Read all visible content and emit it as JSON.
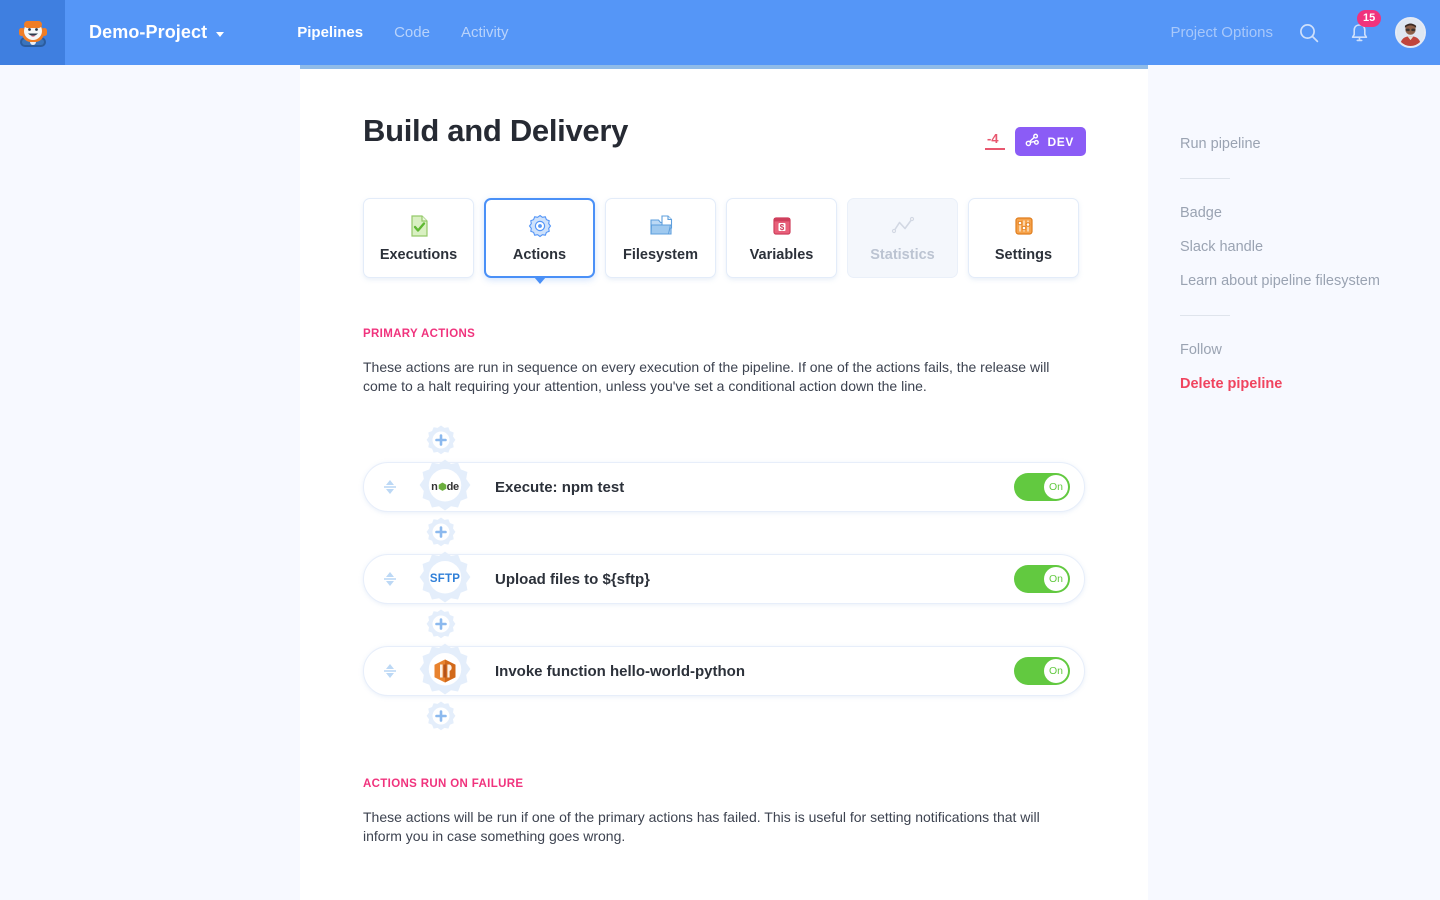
{
  "topbar": {
    "logo_icon": "buddy-robot-logo",
    "project_name": "Demo-Project",
    "nav": [
      {
        "label": "Pipelines",
        "active": true
      },
      {
        "label": "Code",
        "active": false
      },
      {
        "label": "Activity",
        "active": false
      }
    ],
    "project_options": "Project Options",
    "search_icon": "search-icon",
    "notifications_icon": "bell-icon",
    "notifications_count": "15",
    "avatar_icon": "user-avatar",
    "bg_color": "#5596f7",
    "badge_color": "#f0337d"
  },
  "page": {
    "title": "Build and Delivery",
    "change_badge": "-4",
    "env_badge": "DEV",
    "env_badge_color": "#8b5cf6",
    "env_badge_icon": "branch-icon"
  },
  "tabs": [
    {
      "label": "Executions",
      "icon": "document-check-icon",
      "state": "normal"
    },
    {
      "label": "Actions",
      "icon": "gear-icon",
      "state": "active"
    },
    {
      "label": "Filesystem",
      "icon": "folder-icon",
      "state": "normal"
    },
    {
      "label": "Variables",
      "icon": "dollar-card-icon",
      "state": "normal"
    },
    {
      "label": "Statistics",
      "icon": "line-chart-icon",
      "state": "disabled"
    },
    {
      "label": "Settings",
      "icon": "sliders-icon",
      "state": "normal"
    }
  ],
  "primary_section": {
    "heading": "PRIMARY ACTIONS",
    "description": "These actions are run in sequence on every execution of the pipeline. If one of the actions fails, the release will come to a halt requiring your attention, unless you've set a conditional action down the line."
  },
  "actions": [
    {
      "label": "Execute: npm test",
      "icon": "nodejs-icon",
      "toggle_label": "On",
      "toggle_on": true
    },
    {
      "label": "Upload files to ${sftp}",
      "icon": "sftp-icon",
      "toggle_label": "On",
      "toggle_on": true
    },
    {
      "label": "Invoke function hello-world-python",
      "icon": "aws-lambda-icon",
      "toggle_label": "On",
      "toggle_on": true
    }
  ],
  "add_button_icon": "plus-gear-icon",
  "failure_section": {
    "heading": "ACTIONS RUN ON FAILURE",
    "description": "These actions will be run if one of the primary actions has failed. This is useful for setting notifications that will inform you in case something goes wrong."
  },
  "right_rail": {
    "groups": [
      {
        "items": [
          {
            "label": "Run pipeline",
            "danger": false
          }
        ]
      },
      {
        "items": [
          {
            "label": "Badge",
            "danger": false
          },
          {
            "label": "Slack handle",
            "danger": false
          },
          {
            "label": "Learn about pipeline filesystem",
            "danger": false
          }
        ]
      },
      {
        "items": [
          {
            "label": "Follow",
            "danger": false
          },
          {
            "label": "Delete pipeline",
            "danger": true
          }
        ]
      }
    ]
  },
  "colors": {
    "accent_blue": "#4a90f7",
    "pink": "#f0337d",
    "green": "#62c940",
    "purple": "#8b5cf6",
    "danger_red": "#f0445f"
  }
}
